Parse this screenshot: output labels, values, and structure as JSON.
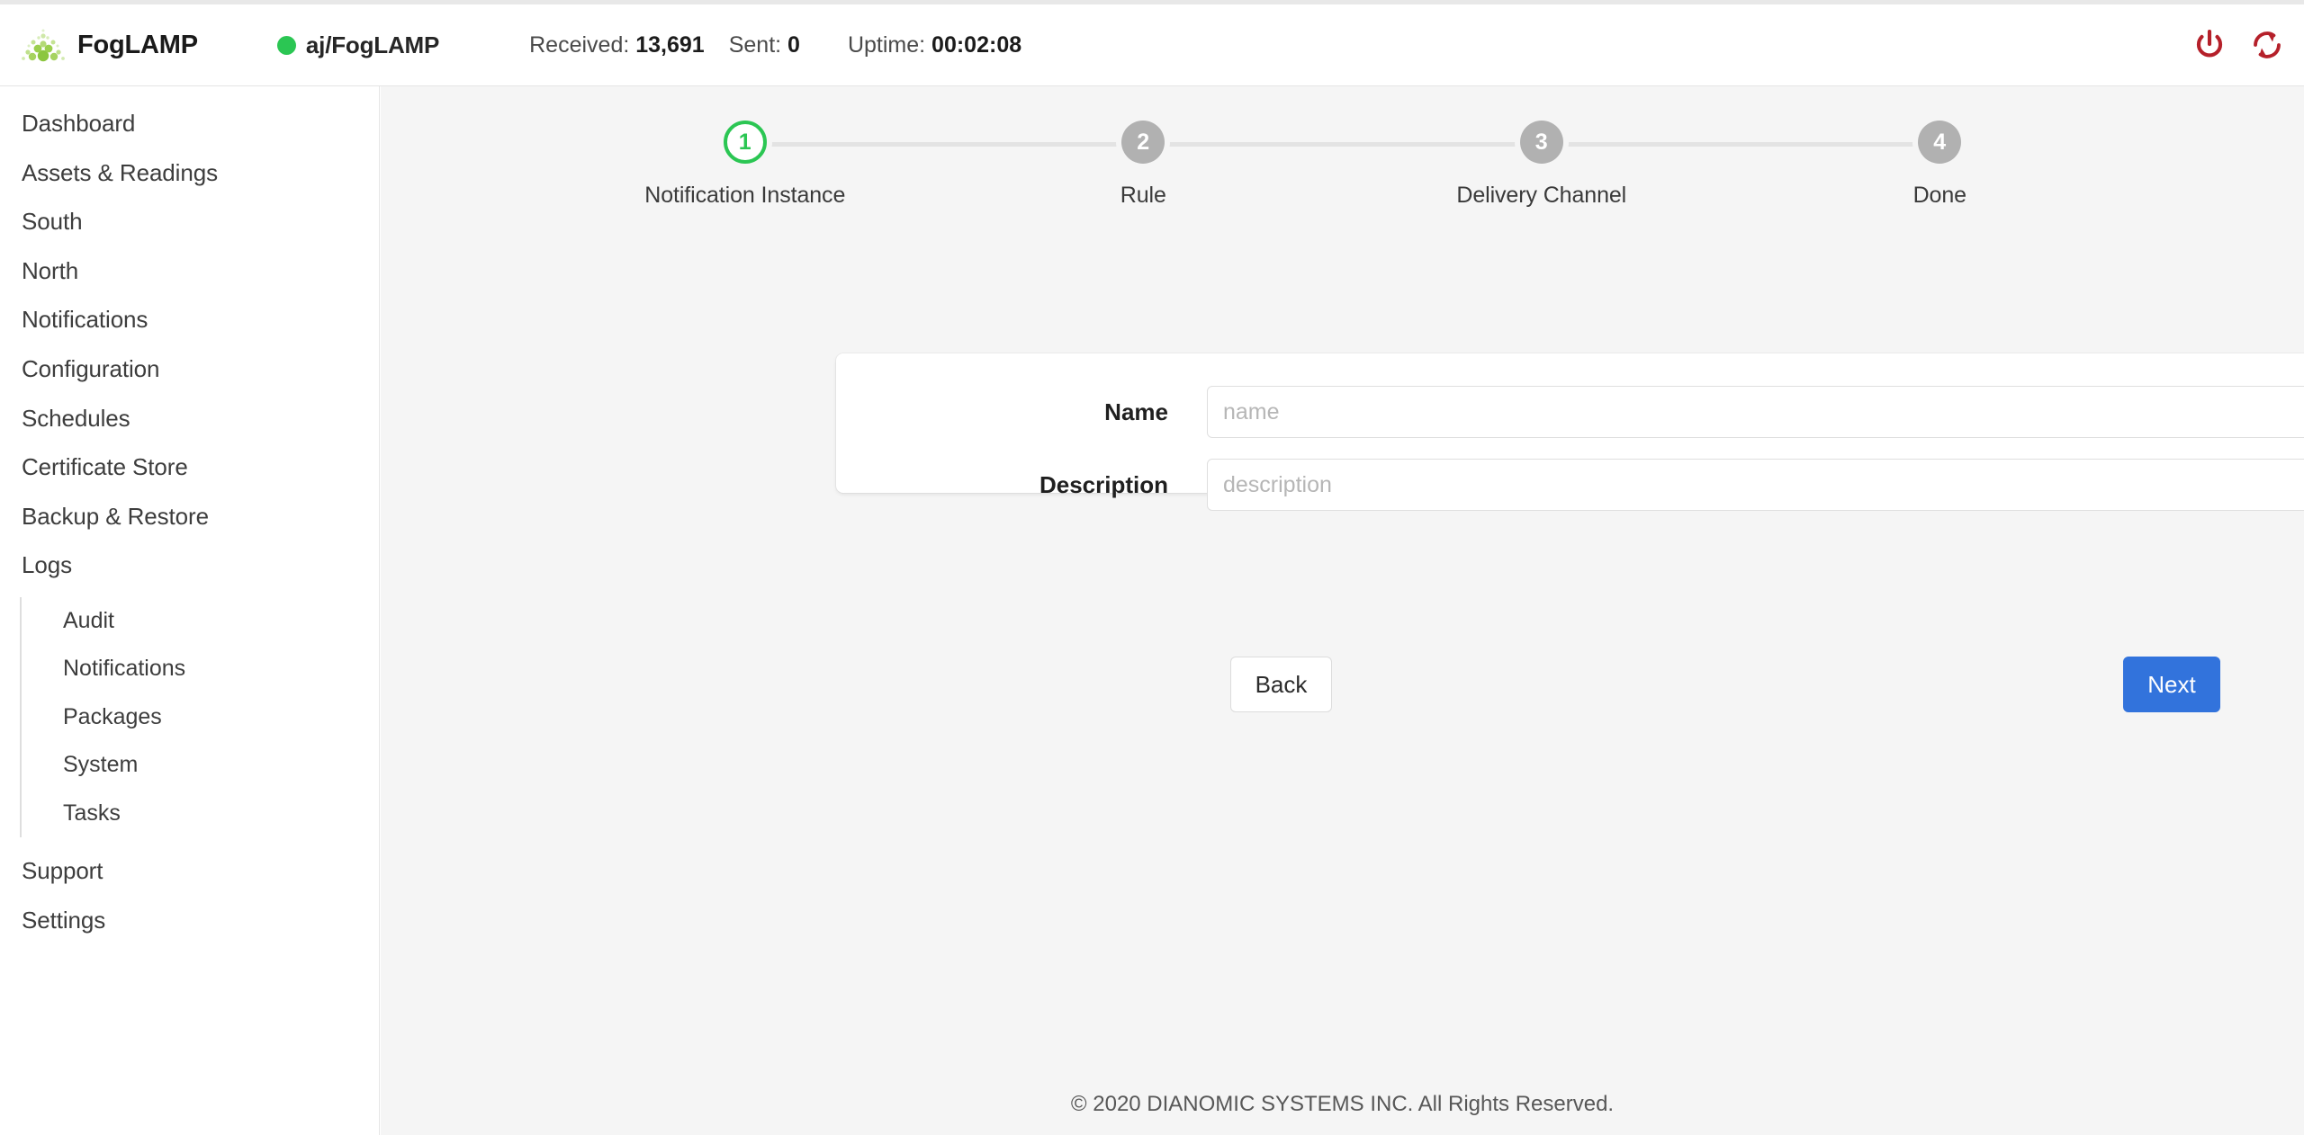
{
  "header": {
    "brand": "FogLAMP",
    "logo_icon": "fog-dots-logo-icon",
    "ping_name": "aj/FogLAMP",
    "status_dot_color": "#2bc653",
    "stats": {
      "received_label": "Received:",
      "received_value": "13,691",
      "sent_label": "Sent:",
      "sent_value": "0",
      "uptime_label": "Uptime:",
      "uptime_value": "00:02:08"
    },
    "actions": [
      {
        "icon": "power-icon",
        "color": "#b5202a"
      },
      {
        "icon": "refresh-sync-icon",
        "color": "#b5202a"
      }
    ]
  },
  "sidebar": {
    "items": [
      {
        "label": "Dashboard"
      },
      {
        "label": "Assets & Readings"
      },
      {
        "label": "South"
      },
      {
        "label": "North"
      },
      {
        "label": "Notifications"
      },
      {
        "label": "Configuration"
      },
      {
        "label": "Schedules"
      },
      {
        "label": "Certificate Store"
      },
      {
        "label": "Backup & Restore"
      },
      {
        "label": "Logs"
      }
    ],
    "sub_items": [
      {
        "label": "Audit"
      },
      {
        "label": "Notifications"
      },
      {
        "label": "Packages"
      },
      {
        "label": "System"
      },
      {
        "label": "Tasks"
      }
    ],
    "footer_items": [
      {
        "label": "Support"
      },
      {
        "label": "Settings"
      }
    ]
  },
  "wizard": {
    "active_color": "#2bc653",
    "idle_color": "#b1b1b1",
    "steps": [
      {
        "number": "1",
        "label": "Notification Instance",
        "state": "active"
      },
      {
        "number": "2",
        "label": "Rule",
        "state": "idle"
      },
      {
        "number": "3",
        "label": "Delivery Channel",
        "state": "idle"
      },
      {
        "number": "4",
        "label": "Done",
        "state": "idle"
      }
    ]
  },
  "form": {
    "fields": [
      {
        "label": "Name",
        "value": "",
        "placeholder": "name"
      },
      {
        "label": "Description",
        "value": "",
        "placeholder": "description"
      }
    ]
  },
  "buttons": {
    "back": "Back",
    "next": "Next",
    "next_color": "#3273dc"
  },
  "footer": {
    "copyright": "© 2020 DIANOMIC SYSTEMS INC. All Rights Reserved."
  }
}
